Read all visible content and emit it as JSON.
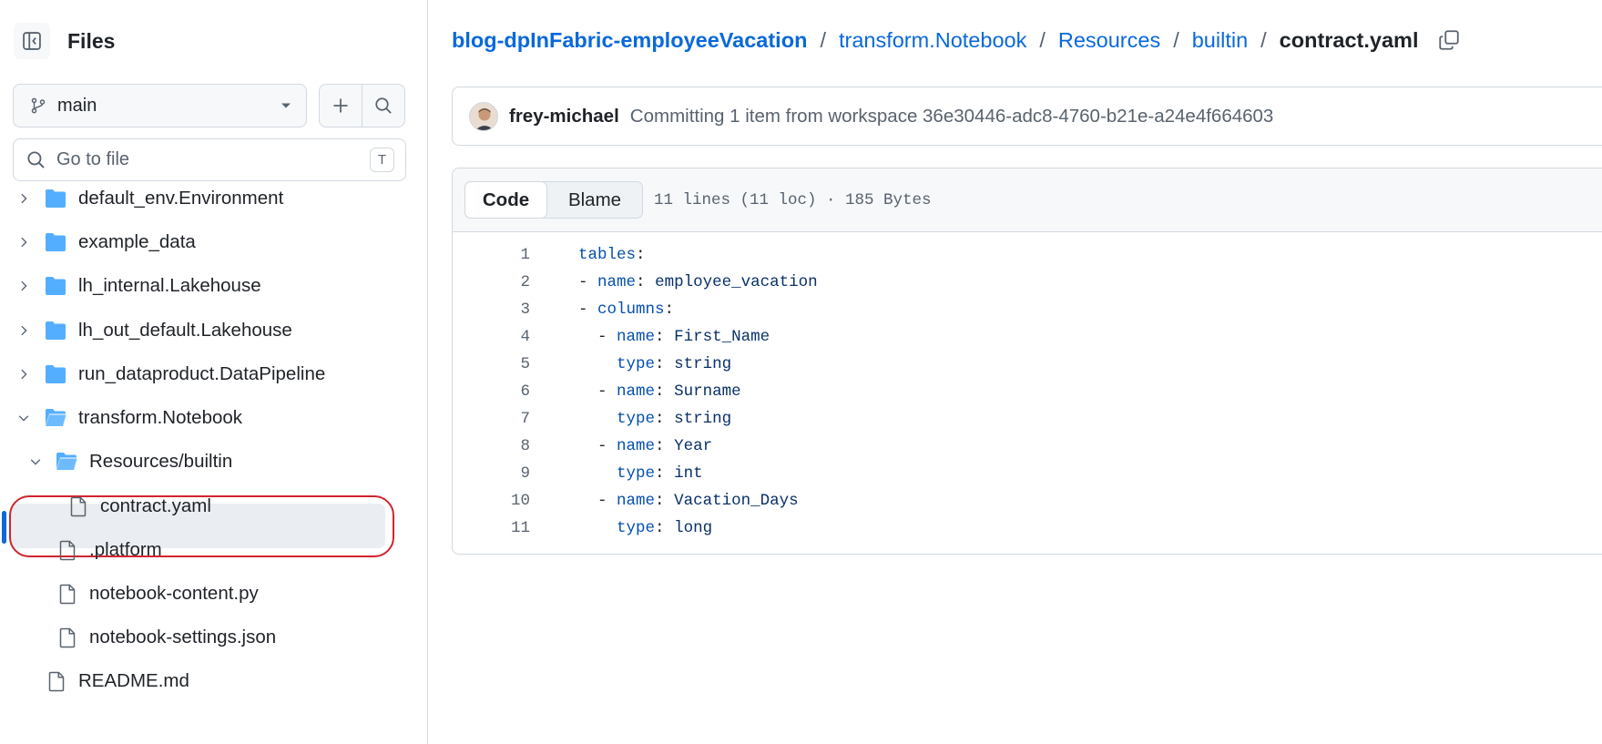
{
  "sidebar": {
    "title": "Files",
    "branch": "main",
    "goto_placeholder": "Go to file",
    "goto_shortcut": "T",
    "tree": [
      {
        "label": "default_env.Environment",
        "type": "folder",
        "depth": 0,
        "expanded": false
      },
      {
        "label": "example_data",
        "type": "folder",
        "depth": 0,
        "expanded": false
      },
      {
        "label": "lh_internal.Lakehouse",
        "type": "folder",
        "depth": 0,
        "expanded": false
      },
      {
        "label": "lh_out_default.Lakehouse",
        "type": "folder",
        "depth": 0,
        "expanded": false
      },
      {
        "label": "run_dataproduct.DataPipeline",
        "type": "folder",
        "depth": 0,
        "expanded": false
      },
      {
        "label": "transform.Notebook",
        "type": "folder",
        "depth": 0,
        "expanded": true
      },
      {
        "label": "Resources/builtin",
        "type": "folder",
        "depth": 1,
        "expanded": true
      },
      {
        "label": "contract.yaml",
        "type": "file",
        "depth": 2,
        "selected": true
      },
      {
        "label": ".platform",
        "type": "file",
        "depth": 1
      },
      {
        "label": "notebook-content.py",
        "type": "file",
        "depth": 1
      },
      {
        "label": "notebook-settings.json",
        "type": "file",
        "depth": 1
      },
      {
        "label": "README.md",
        "type": "file",
        "depth": 0
      }
    ]
  },
  "breadcrumb": {
    "repo": "blog-dpInFabric-employeeVacation",
    "parts": [
      "transform.Notebook",
      "Resources",
      "builtin"
    ],
    "current": "contract.yaml",
    "separator": "/"
  },
  "commit": {
    "author": "frey-michael",
    "message": "Committing 1 item from workspace 36e30446-adc8-4760-b21e-a24e4f664603"
  },
  "file": {
    "tabs": {
      "code": "Code",
      "blame": "Blame"
    },
    "meta": "11 lines (11 loc) · 185 Bytes",
    "lines": [
      {
        "n": "1",
        "indent": "",
        "dash": "",
        "key": "tables",
        "value": ""
      },
      {
        "n": "2",
        "indent": "",
        "dash": "- ",
        "key": "name",
        "value": "employee_vacation"
      },
      {
        "n": "3",
        "indent": "",
        "dash": "- ",
        "key": "columns",
        "value": ""
      },
      {
        "n": "4",
        "indent": "  ",
        "dash": "- ",
        "key": "name",
        "value": "First_Name"
      },
      {
        "n": "5",
        "indent": "    ",
        "dash": "",
        "key": "type",
        "value": "string"
      },
      {
        "n": "6",
        "indent": "  ",
        "dash": "- ",
        "key": "name",
        "value": "Surname"
      },
      {
        "n": "7",
        "indent": "    ",
        "dash": "",
        "key": "type",
        "value": "string"
      },
      {
        "n": "8",
        "indent": "  ",
        "dash": "- ",
        "key": "name",
        "value": "Year"
      },
      {
        "n": "9",
        "indent": "    ",
        "dash": "",
        "key": "type",
        "value": "int"
      },
      {
        "n": "10",
        "indent": "  ",
        "dash": "- ",
        "key": "name",
        "value": "Vacation_Days"
      },
      {
        "n": "11",
        "indent": "    ",
        "dash": "",
        "key": "type",
        "value": "long"
      }
    ]
  },
  "colors": {
    "link": "#0969da",
    "folder": "#54aeff",
    "highlight": "#d1242f",
    "selected_bar": "#0969da"
  }
}
